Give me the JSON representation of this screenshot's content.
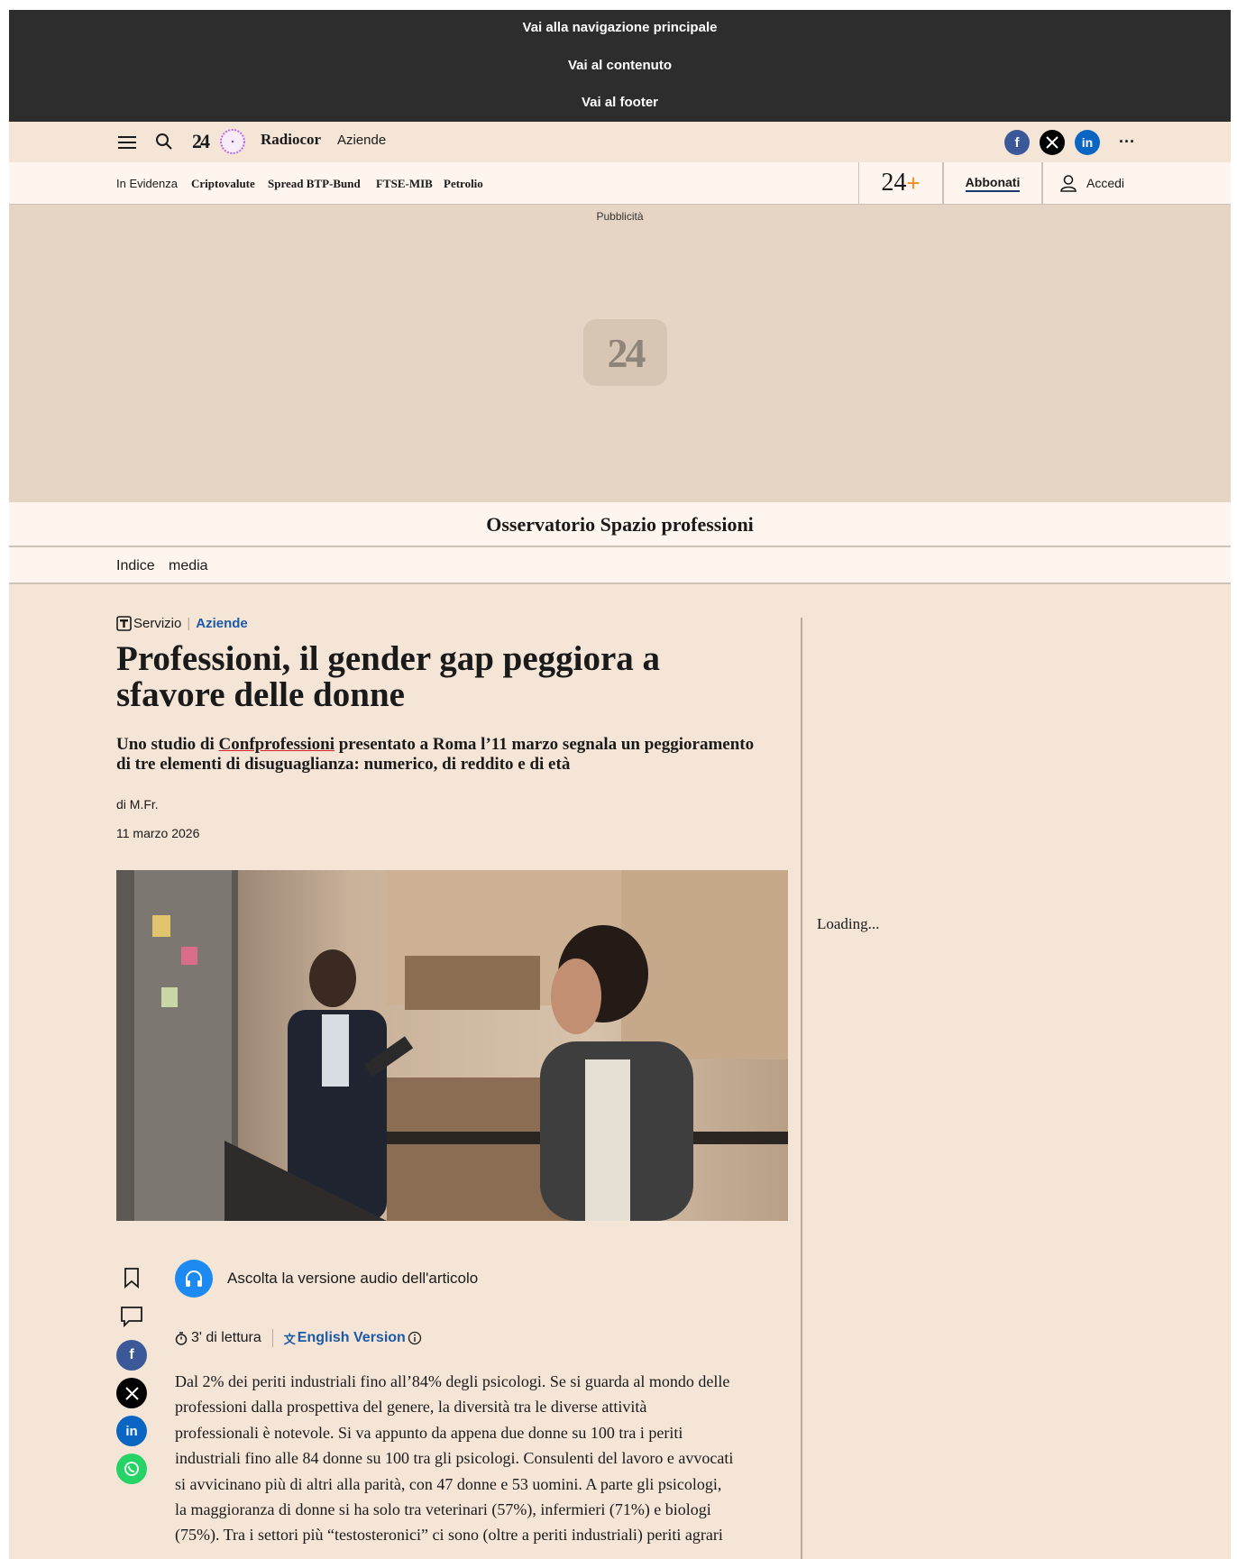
{
  "skip_links": [
    "Vai alla navigazione principale",
    "Vai al contenuto",
    "Vai al footer"
  ],
  "topbar": {
    "logo_text": "24",
    "brand": "Radiocor",
    "brand_sub": "Aziende",
    "more": "···",
    "icons": [
      "menu-icon",
      "search-icon",
      "24-logo",
      "radiocor-clock-icon",
      "facebook-icon",
      "x-icon",
      "linkedin-icon",
      "more-icon"
    ]
  },
  "navbar": {
    "items": [
      "In Evidenza",
      "Criptovalute",
      "Spread BTP-Bund",
      "FTSE-MIB",
      "Petrolio"
    ],
    "plus_logo": "24",
    "plus_sign": "+",
    "subscribe": "Abbonati",
    "login": "Accedi"
  },
  "ad": {
    "label": "Pubblicità",
    "logo": "24"
  },
  "section": {
    "title": "Osservatorio Spazio professioni"
  },
  "subnav": {
    "items": [
      "Indice",
      "media"
    ]
  },
  "article": {
    "kicker_type": "Servizio",
    "kicker_category": "Aziende",
    "title": "Professioni, il gender gap peggiora a sfavore delle donne",
    "subtitle_pre": "Uno studio di ",
    "subtitle_link": "Confprofessioni",
    "subtitle_post": " presentato a Roma l’11 marzo segnala un peggioramento di tre elementi di disuguaglianza: numerico, di reddito e di età",
    "author": "di M.Fr.",
    "date": "11 marzo 2026",
    "audio_label": "Ascolta la versione audio dell'articolo",
    "reading_time": "3' di lettura",
    "english_version": "English Version",
    "body": "Dal 2% dei periti industriali fino all’84% degli psicologi. Se si guarda al mondo delle professioni dalla prospettiva del genere, la diversità tra le diverse attività professionali è notevole. Si va appunto da appena due donne su 100 tra i periti industriali fino alle 84 donne su 100 tra gli psicologi. Consulenti del lavoro e avvocati si avvicinano più di altri alla parità, con 47 donne e 53 uomini. A parte gli psicologi, la maggioranza di donne si ha solo tra veterinari (57%), infermieri (71%) e biologi (75%). Tra i settori più “testosteronici” ci sono (oltre a periti industriali) periti agrari"
  },
  "sidebar": {
    "loading": "Loading..."
  },
  "colors": {
    "page_bg": "#f4e5d7",
    "skip_bg": "#2d2d2d",
    "nav_bg": "#fef6ee",
    "ad_bg": "#e6d5c4",
    "accent_blue": "#1c5aa8",
    "audio_blue": "#1c8af0",
    "facebook": "#3b5998",
    "linkedin": "#0a66c2",
    "whatsapp": "#25d366",
    "plus_orange": "#f28c1e"
  }
}
